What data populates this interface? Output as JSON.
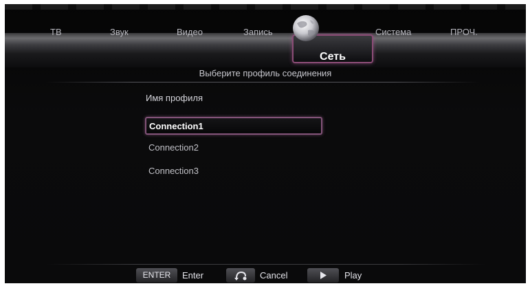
{
  "menu": {
    "tabs": [
      {
        "label": "ТВ"
      },
      {
        "label": "Звук"
      },
      {
        "label": "Видео"
      },
      {
        "label": "Запись"
      },
      {
        "label": "Сеть"
      },
      {
        "label": "Система"
      },
      {
        "label": "ПРОЧ."
      }
    ],
    "active_tab": "Сеть",
    "active_icon": "globe-icon"
  },
  "subtitle": "Выберите профиль соединения",
  "profiles": {
    "heading": "Имя профиля",
    "items": [
      "Connection1",
      "Connection2",
      "Connection3"
    ],
    "selected": "Connection1"
  },
  "footer": {
    "enter_key": "ENTER",
    "enter_label": "Enter",
    "cancel_icon": "return-icon",
    "cancel_label": "Cancel",
    "play_icon": "play-icon",
    "play_label": "Play"
  },
  "colors": {
    "accent_border": "#8b4c76",
    "background": "#0a0a0b"
  }
}
